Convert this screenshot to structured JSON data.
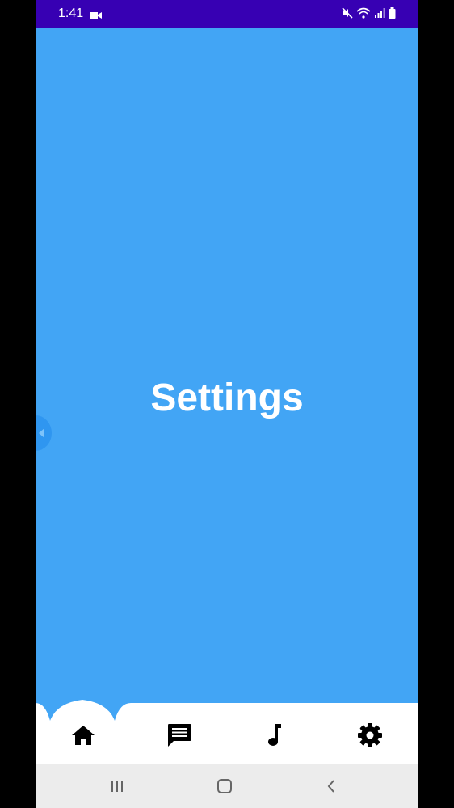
{
  "status_bar": {
    "time": "1:41",
    "icons": [
      "video-camera-icon",
      "mute-icon",
      "wifi-icon",
      "signal-icon",
      "battery-icon"
    ],
    "background": "#3700B3"
  },
  "main": {
    "title": "Settings",
    "background": "#42A5F5"
  },
  "bottom_nav": {
    "items": [
      {
        "icon": "home-icon",
        "selected": true
      },
      {
        "icon": "message-icon",
        "selected": false
      },
      {
        "icon": "music-note-icon",
        "selected": false
      },
      {
        "icon": "gear-icon",
        "selected": false
      }
    ]
  },
  "system_nav": {
    "buttons": [
      "recent-apps-icon",
      "home-button-icon",
      "back-icon"
    ],
    "background": "#ECECEC"
  }
}
